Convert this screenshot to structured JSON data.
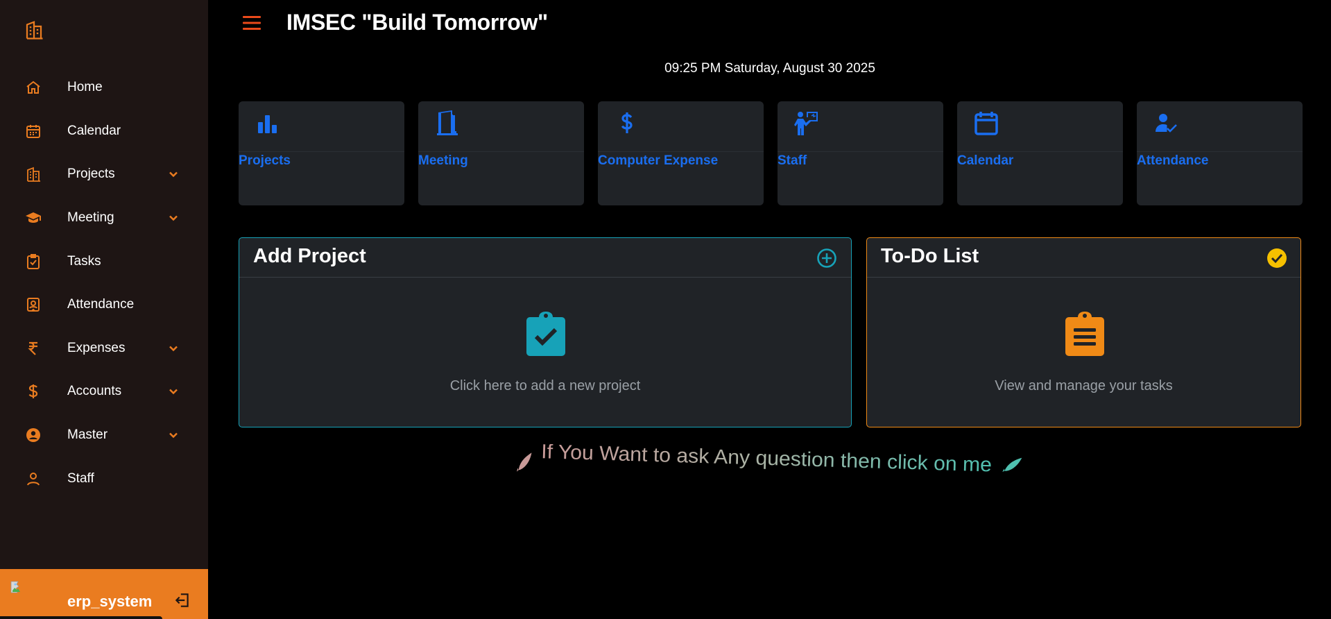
{
  "colors": {
    "sidebar_bg": "#1e1514",
    "accent_orange": "#ea7c20",
    "card_bg": "#202327",
    "card_label_blue": "#1a6ef0",
    "add_project_teal": "#17a2b8",
    "todo_orange": "#f08a16",
    "todo_check_yellow": "#f5c000"
  },
  "sidebar": {
    "logo_icon": "building-icon",
    "items": [
      {
        "label": "Home",
        "icon": "home-icon",
        "has_submenu": false
      },
      {
        "label": "Calendar",
        "icon": "calendar-icon",
        "has_submenu": false
      },
      {
        "label": "Projects",
        "icon": "building-icon",
        "has_submenu": true
      },
      {
        "label": "Meeting",
        "icon": "graduation-cap-icon",
        "has_submenu": true
      },
      {
        "label": "Tasks",
        "icon": "clipboard-check-icon",
        "has_submenu": false
      },
      {
        "label": "Attendance",
        "icon": "id-badge-icon",
        "has_submenu": false
      },
      {
        "label": "Expenses",
        "icon": "rupee-icon",
        "has_submenu": true
      },
      {
        "label": "Accounts",
        "icon": "dollar-icon",
        "has_submenu": true
      },
      {
        "label": "Master",
        "icon": "user-circle-icon",
        "has_submenu": true
      },
      {
        "label": "Staff",
        "icon": "user-icon",
        "has_submenu": false
      }
    ],
    "user": {
      "username": "erp_system",
      "logout_icon": "logout-icon"
    }
  },
  "header": {
    "title": "IMSEC \"Build Tomorrow\"",
    "datetime": "09:25 PM Saturday, August 30 2025"
  },
  "cards": [
    {
      "label": "Projects",
      "icon": "bar-chart-icon"
    },
    {
      "label": "Meeting",
      "icon": "door-open-icon"
    },
    {
      "label": "Computer Expense",
      "icon": "dollar-icon"
    },
    {
      "label": "Staff",
      "icon": "person-chalkboard-icon"
    },
    {
      "label": "Calendar",
      "icon": "calendar-icon"
    },
    {
      "label": "Attendance",
      "icon": "user-check-icon"
    }
  ],
  "add_project": {
    "title": "Add Project",
    "description": "Click here to add a new project",
    "header_icon": "plus-circle-icon",
    "main_icon": "clipboard-check-icon"
  },
  "todo": {
    "title": "To-Do List",
    "description": "View and manage your tasks",
    "header_icon": "check-circle-icon",
    "main_icon": "clipboard-list-icon"
  },
  "ask": {
    "text": "If You Want to ask Any question then click on me",
    "icon": "rocket-icon"
  }
}
